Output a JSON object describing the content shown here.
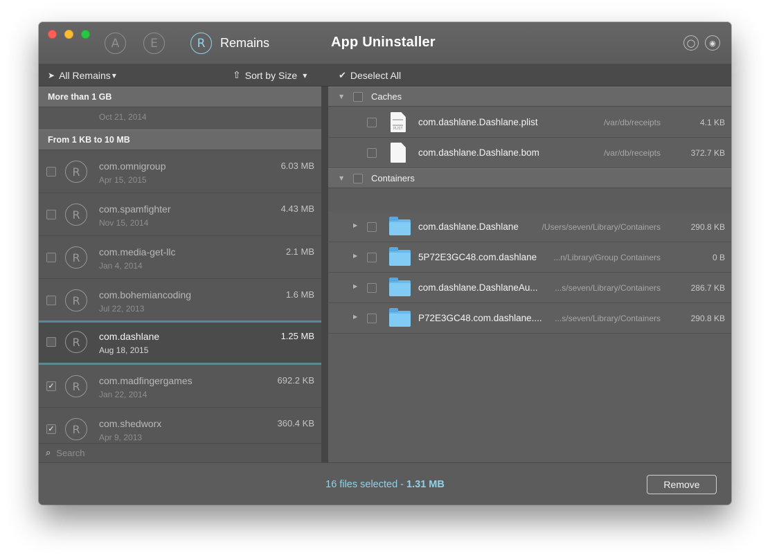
{
  "window": {
    "title": "App Uninstaller",
    "active_section": "Remains",
    "nav_icons": [
      {
        "icon": "app-store-icon",
        "glyph": "A"
      },
      {
        "icon": "extensions-icon",
        "glyph": "E"
      },
      {
        "icon": "remains-icon",
        "glyph": "R"
      }
    ],
    "right_buttons": [
      {
        "icon": "chat-bubble-icon",
        "glyph": "◯"
      },
      {
        "icon": "rss-icon",
        "glyph": "◉"
      }
    ]
  },
  "toolbar": {
    "filter_label": "All Remains",
    "sort_label": "Sort by Size",
    "deselect_label": "Deselect All"
  },
  "left_panel": {
    "groups": [
      {
        "label": "More than 1 GB"
      },
      {
        "label": "From 1 KB to 10 MB"
      }
    ],
    "partial_row": {
      "date": "Oct 21, 2014"
    },
    "apps": [
      {
        "name": "com.omnigroup",
        "date": "Apr 15, 2015",
        "size": "6.03 MB",
        "checked": false
      },
      {
        "name": "com.spamfighter",
        "date": "Nov 15, 2014",
        "size": "4.43 MB",
        "checked": false
      },
      {
        "name": "com.media-get-llc",
        "date": "Jan 4, 2014",
        "size": "2.1 MB",
        "checked": false
      },
      {
        "name": "com.bohemiancoding",
        "date": "Jul 22, 2013",
        "size": "1.6 MB",
        "checked": false
      },
      {
        "name": "com.dashlane",
        "date": "Aug 18, 2015",
        "size": "1.25 MB",
        "checked": false
      },
      {
        "name": "com.madfingergames",
        "date": "Jan 22, 2014",
        "size": "692.2 KB",
        "checked": true
      },
      {
        "name": "com.shedworx",
        "date": "Apr 9, 2013",
        "size": "360.4 KB",
        "checked": true
      }
    ],
    "search_placeholder": "Search"
  },
  "right_panel": {
    "categories": [
      {
        "label": "Caches",
        "files": [
          {
            "name": "com.dashlane.Dashlane.plist",
            "path": "/var/db/receipts",
            "size": "4.1 KB",
            "icon": "plist-file-icon",
            "icon_label": "PLIST"
          },
          {
            "name": "com.dashlane.Dashlane.bom",
            "path": "/var/db/receipts",
            "size": "372.7 KB",
            "icon": "document-icon"
          }
        ]
      },
      {
        "label": "Containers",
        "files": [
          {
            "name": "com.dashlane.Dashlane",
            "path": "/Users/seven/Library/Containers",
            "size": "290.8 KB",
            "icon": "folder-icon"
          },
          {
            "name": "5P72E3GC48.com.dashlane",
            "path": "...n/Library/Group Containers",
            "size": "0 B",
            "icon": "folder-icon"
          },
          {
            "name": "com.dashlane.DashlaneAu...",
            "path": "...s/seven/Library/Containers",
            "size": "286.7 KB",
            "icon": "folder-icon"
          },
          {
            "name": "P72E3GC48.com.dashlane....",
            "path": "...s/seven/Library/Containers",
            "size": "290.8 KB",
            "icon": "folder-icon"
          }
        ]
      }
    ]
  },
  "footer": {
    "status_count": "16 files selected - ",
    "status_size": "1.31 MB",
    "remove_label": "Remove"
  },
  "colors": {
    "accent": "#8fd3ea",
    "folder": "#82cbf5",
    "window_bg": "#5c5c5c"
  }
}
